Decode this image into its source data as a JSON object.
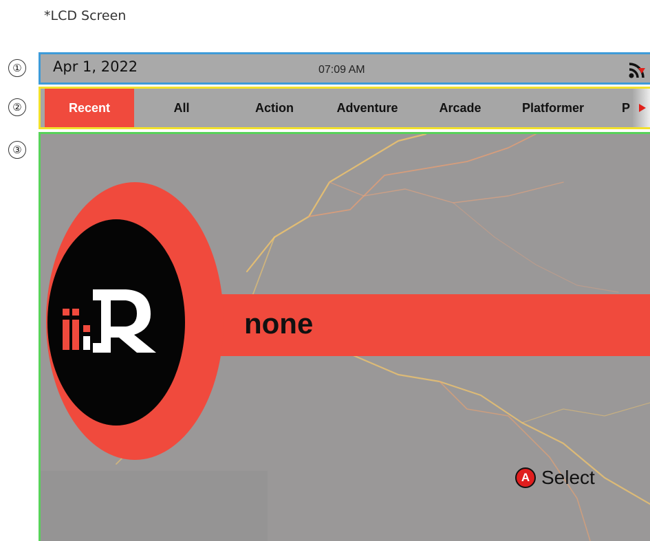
{
  "caption": "*LCD Screen",
  "markers": [
    "①",
    "②",
    "③"
  ],
  "statusbar": {
    "date": "Apr 1, 2022",
    "time": "07:09 AM",
    "wifi_icon": "wifi-icon"
  },
  "tabs": [
    {
      "label": "Recent",
      "active": true
    },
    {
      "label": "All",
      "active": false
    },
    {
      "label": "Action",
      "active": false
    },
    {
      "label": "Adventure",
      "active": false
    },
    {
      "label": "Arcade",
      "active": false
    },
    {
      "label": "Platformer",
      "active": false
    },
    {
      "label": "P",
      "active": false
    }
  ],
  "main": {
    "title": "none",
    "hint_button": "A",
    "hint_label": "Select"
  },
  "colors": {
    "accent": "#f04a3d",
    "region1_border": "#3d9bd9",
    "region2_border": "#f2e12c",
    "region3_border": "#58d25a"
  }
}
